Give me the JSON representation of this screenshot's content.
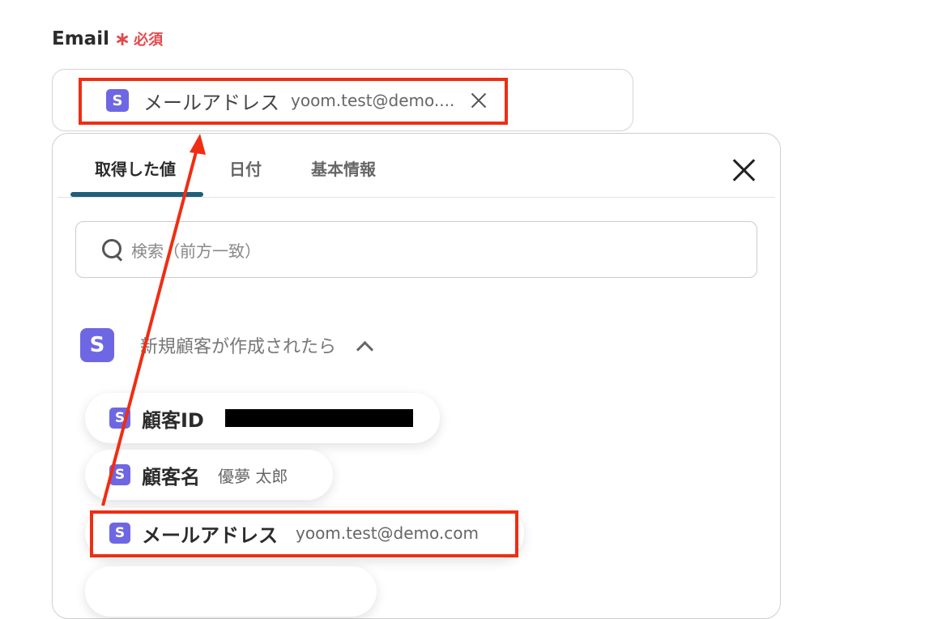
{
  "field": {
    "label": "Email",
    "required_mark": "∗",
    "required_text": "必須"
  },
  "input": {
    "chip": {
      "badge": "S",
      "label": "メールアドレス",
      "value": "yoom.test@demo...."
    }
  },
  "popover": {
    "tabs": [
      {
        "label": "取得した値"
      },
      {
        "label": "日付"
      },
      {
        "label": "基本情報"
      }
    ],
    "search": {
      "placeholder": "検索（前方一致）"
    },
    "group": {
      "badge": "S",
      "title": "新規顧客が作成されたら"
    },
    "items": [
      {
        "badge": "S",
        "label": "顧客ID",
        "value": ""
      },
      {
        "badge": "S",
        "label": "顧客名",
        "value": "優夢 太郎"
      },
      {
        "badge": "S",
        "label": "メールアドレス",
        "value": "yoom.test@demo.com"
      }
    ]
  },
  "annotation": {
    "color": "#f02d12"
  },
  "colors": {
    "brand": "#6e67e3",
    "required": "#e5484d",
    "active_tab": "#1f5f7a"
  }
}
